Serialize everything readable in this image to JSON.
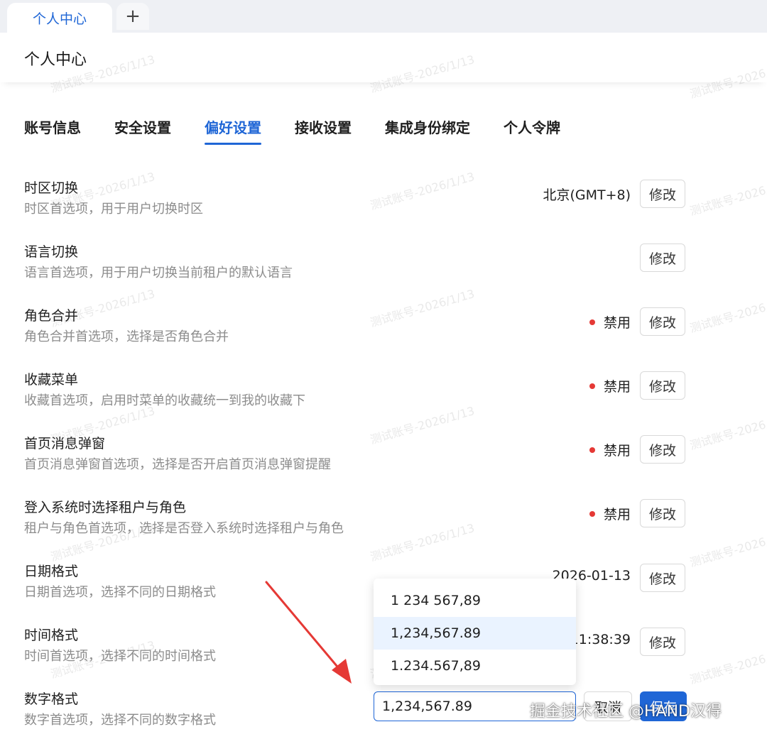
{
  "tabs": {
    "active_label": "个人中心",
    "add_label": "+"
  },
  "header": {
    "title": "个人中心"
  },
  "watermark": "测试账号-2026/1/13",
  "nav": {
    "items": [
      "账号信息",
      "安全设置",
      "偏好设置",
      "接收设置",
      "集成身份绑定",
      "个人令牌"
    ],
    "active_index": 2
  },
  "settings": [
    {
      "title": "时区切换",
      "desc": "时区首选项，用于用户切换时区",
      "value": "北京(GMT+8)",
      "edit": "修改"
    },
    {
      "title": "语言切换",
      "desc": "语言首选项，用于用户切换当前租户的默认语言",
      "value": "",
      "edit": "修改"
    },
    {
      "title": "角色合并",
      "desc": "角色合并首选项，选择是否角色合并",
      "value": "禁用",
      "edit": "修改"
    },
    {
      "title": "收藏菜单",
      "desc": "收藏首选项，启用时菜单的收藏统一到我的收藏下",
      "value": "禁用",
      "edit": "修改"
    },
    {
      "title": "首页消息弹窗",
      "desc": "首页消息弹窗首选项，选择是否开启首页消息弹窗提醒",
      "value": "禁用",
      "edit": "修改"
    },
    {
      "title": "登入系统时选择租户与角色",
      "desc": "租户与角色首选项，选择是否登入系统时选择租户与角色",
      "value": "禁用",
      "edit": "修改"
    },
    {
      "title": "日期格式",
      "desc": "日期首选项，选择不同的日期格式",
      "value": "2026-01-13",
      "edit": "修改"
    },
    {
      "title": "时间格式",
      "desc": "时间首选项，选择不同的时间格式",
      "value": "11:38:39",
      "edit": "修改"
    },
    {
      "title": "数字格式",
      "desc": "数字首选项，选择不同的数字格式"
    }
  ],
  "number_format": {
    "options": [
      "1 234 567,89",
      "1,234,567.89",
      "1.234.567,89"
    ],
    "selected_index": 1,
    "input_value": "1,234,567.89",
    "cancel_label": "取消",
    "save_label": "保存"
  },
  "credit": "掘金技术社区 @HAND汉得",
  "colors": {
    "accent": "#1f66d6",
    "disabled_dot": "#e53935",
    "arrow": "#e53935"
  }
}
